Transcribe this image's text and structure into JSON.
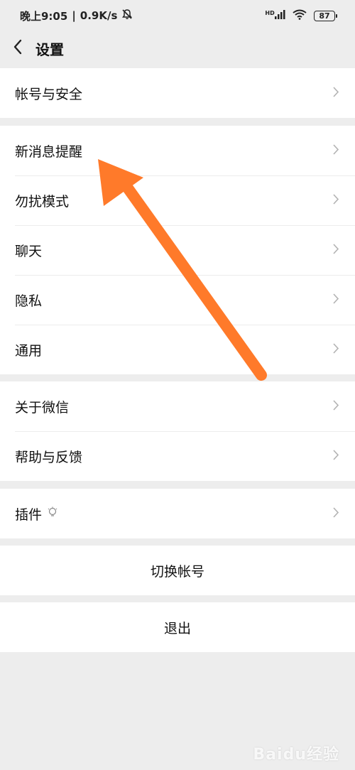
{
  "status_bar": {
    "time": "晚上9:05",
    "speed": "0.9K/s",
    "hd": "HD",
    "battery": "87"
  },
  "nav": {
    "title": "设置"
  },
  "groups": [
    {
      "items": [
        {
          "label": "帐号与安全"
        }
      ]
    },
    {
      "items": [
        {
          "label": "新消息提醒"
        },
        {
          "label": "勿扰模式"
        },
        {
          "label": "聊天"
        },
        {
          "label": "隐私"
        },
        {
          "label": "通用"
        }
      ]
    },
    {
      "items": [
        {
          "label": "关于微信"
        },
        {
          "label": "帮助与反馈"
        }
      ]
    },
    {
      "items": [
        {
          "label": "插件"
        }
      ]
    }
  ],
  "actions": {
    "switch_account": "切换帐号",
    "logout": "退出"
  },
  "watermark": "Baidu经验",
  "colors": {
    "arrow": "#ff7a2a",
    "background": "#ededed",
    "card": "#ffffff"
  }
}
